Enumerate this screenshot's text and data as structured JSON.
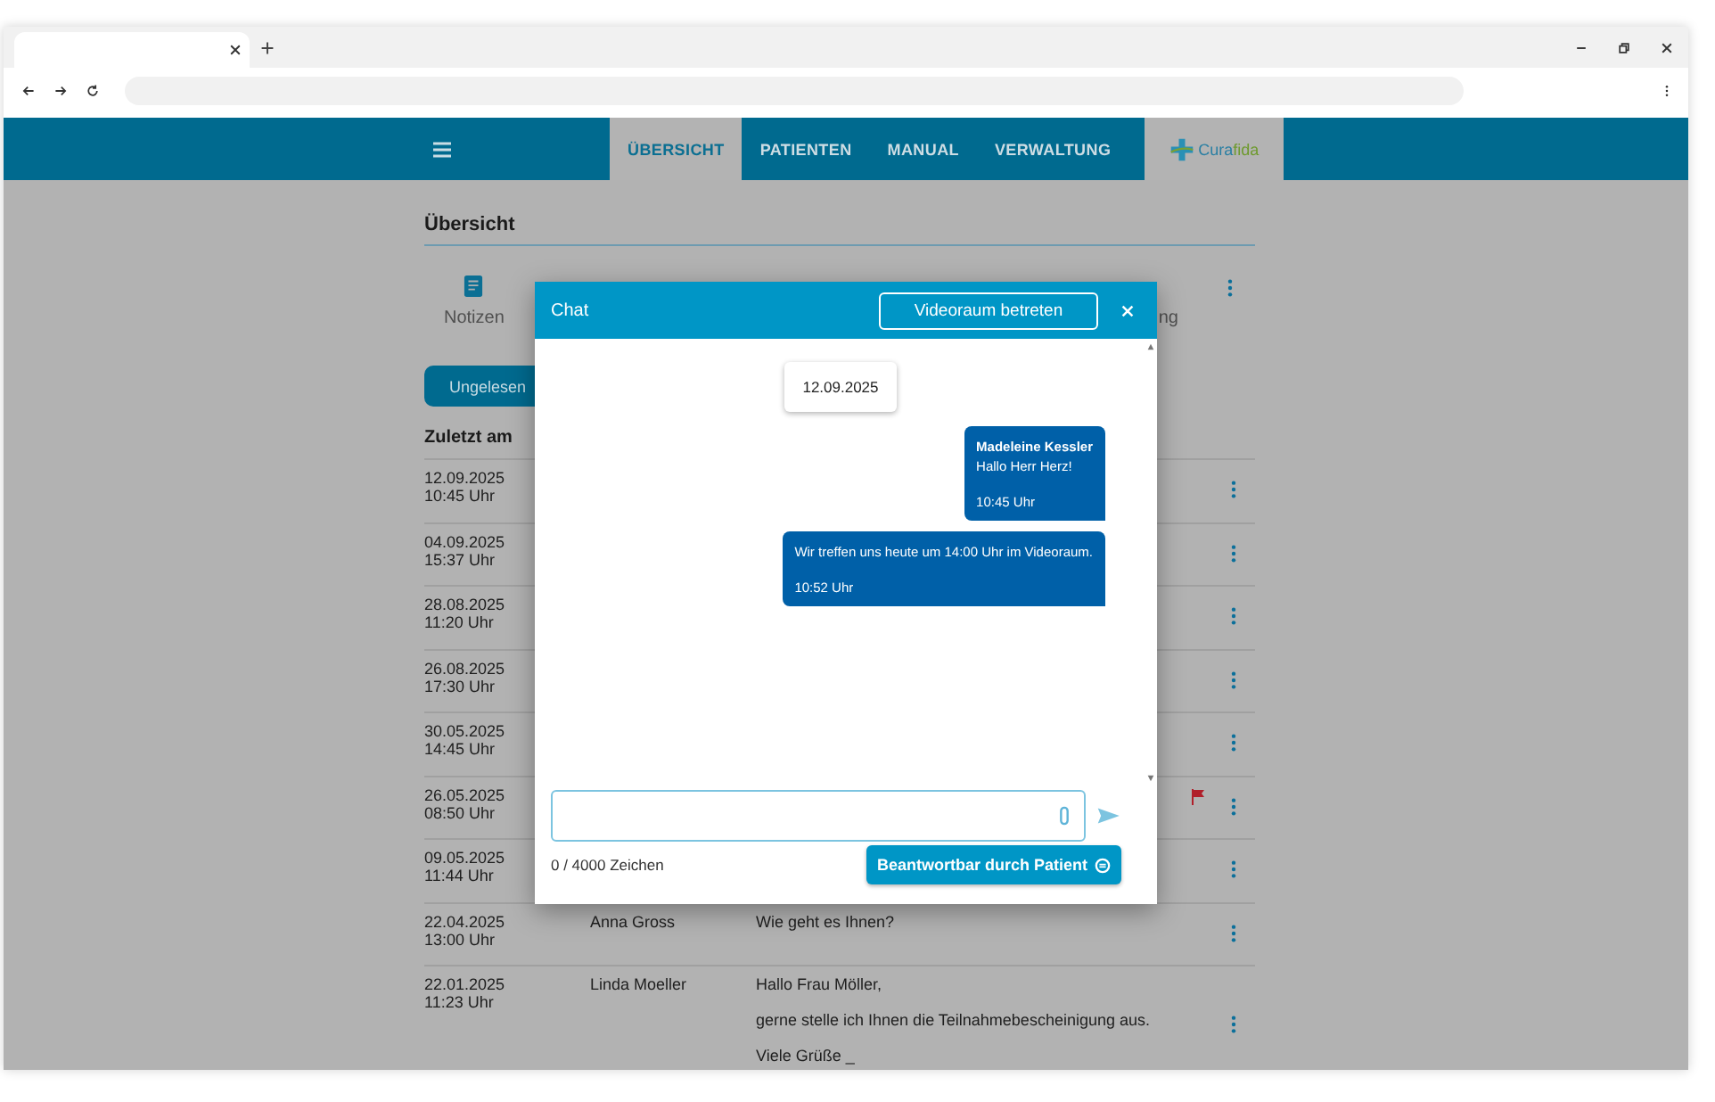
{
  "nav": {
    "tabs": [
      {
        "label": "ÜBERSICHT",
        "selected": true
      },
      {
        "label": "PATIENTEN",
        "selected": false
      },
      {
        "label": "MANUAL",
        "selected": false
      },
      {
        "label": "VERWALTUNG",
        "selected": false
      }
    ],
    "logo": {
      "part_1": "Cura",
      "part_2": "fida"
    }
  },
  "page": {
    "title": "Übersicht",
    "toolbar": {
      "notes_label": "Notizen",
      "cut_label": "ng"
    },
    "filter_button": "Ungelesen",
    "column_header": "Zuletzt am",
    "rows": [
      {
        "date": "12.09.2025",
        "time": "10:45 Uhr",
        "flagged": false
      },
      {
        "date": "04.09.2025",
        "time": "15:37 Uhr",
        "flagged": false
      },
      {
        "date": "28.08.2025",
        "time": "11:20 Uhr",
        "flagged": false
      },
      {
        "date": "26.08.2025",
        "time": "17:30 Uhr",
        "flagged": false
      },
      {
        "date": "30.05.2025",
        "time": "14:45 Uhr",
        "flagged": false
      },
      {
        "date": "26.05.2025",
        "time": "08:50 Uhr",
        "flagged": true
      },
      {
        "date": "09.05.2025",
        "time": "11:44 Uhr",
        "flagged": false
      },
      {
        "date": "22.04.2025",
        "time": "13:00 Uhr",
        "flagged": false,
        "name": "Anna Gross",
        "message": [
          "Wie geht es Ihnen?"
        ]
      },
      {
        "date": "22.01.2025",
        "time": "11:23 Uhr",
        "flagged": false,
        "name": "Linda Moeller",
        "message": [
          "Hallo Frau Möller,",
          "gerne stelle ich Ihnen die Teilnahmebescheinigung aus.",
          "Viele Grüße  _"
        ]
      }
    ]
  },
  "chat": {
    "title": "Chat",
    "video_button": "Videoraum betreten",
    "date_chip": "12.09.2025",
    "messages": [
      {
        "sender": "Madeleine Kessler",
        "text": "Hallo Herr Herz!",
        "time": "10:45 Uhr"
      },
      {
        "text": "Wir treffen uns heute um 14:00 Uhr im Videoraum.",
        "time": "10:52 Uhr"
      }
    ],
    "counter": "0 / 4000 Zeichen",
    "reply_button": "Beantwortbar durch Patient"
  }
}
